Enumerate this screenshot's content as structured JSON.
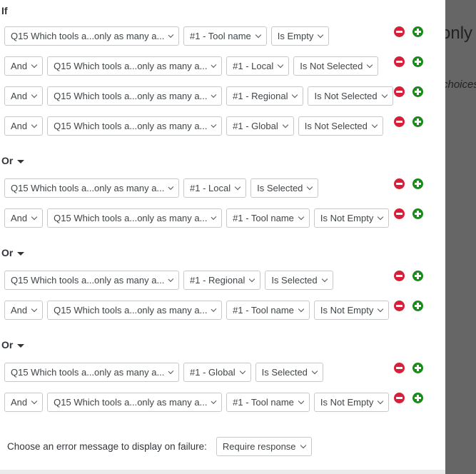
{
  "labels": {
    "if": "If",
    "or": "Or"
  },
  "groups": [
    {
      "rows": [
        {
          "conj": null,
          "question": "Q15 Which tools a...only as many a...",
          "field": "#1 - Tool name",
          "op": "Is Empty"
        },
        {
          "conj": "And",
          "question": "Q15 Which tools a...only as many a...",
          "field": "#1 - Local",
          "op": "Is Not Selected"
        },
        {
          "conj": "And",
          "question": "Q15 Which tools a...only as many a...",
          "field": "#1 - Regional",
          "op": "Is Not Selected"
        },
        {
          "conj": "And",
          "question": "Q15 Which tools a...only as many a...",
          "field": "#1 - Global",
          "op": "Is Not Selected"
        }
      ]
    },
    {
      "rows": [
        {
          "conj": null,
          "question": "Q15 Which tools a...only as many a...",
          "field": "#1 - Local",
          "op": "Is Selected"
        },
        {
          "conj": "And",
          "question": "Q15 Which tools a...only as many a...",
          "field": "#1 - Tool name",
          "op": "Is Not Empty"
        }
      ]
    },
    {
      "rows": [
        {
          "conj": null,
          "question": "Q15 Which tools a...only as many a...",
          "field": "#1 - Regional",
          "op": "Is Selected"
        },
        {
          "conj": "And",
          "question": "Q15 Which tools a...only as many a...",
          "field": "#1 - Tool name",
          "op": "Is Not Empty"
        }
      ]
    },
    {
      "rows": [
        {
          "conj": null,
          "question": "Q15 Which tools a...only as many a...",
          "field": "#1 - Global",
          "op": "Is Selected"
        },
        {
          "conj": "And",
          "question": "Q15 Which tools a...only as many a...",
          "field": "#1 - Tool name",
          "op": "Is Not Empty"
        }
      ]
    }
  ],
  "footer": {
    "label": "Choose an error message to display on failure:",
    "value": "Require response"
  },
  "background": {
    "text1": "only a",
    "text2": "choices"
  },
  "colors": {
    "remove": "#d81f3a",
    "add": "#1a8a1a"
  }
}
